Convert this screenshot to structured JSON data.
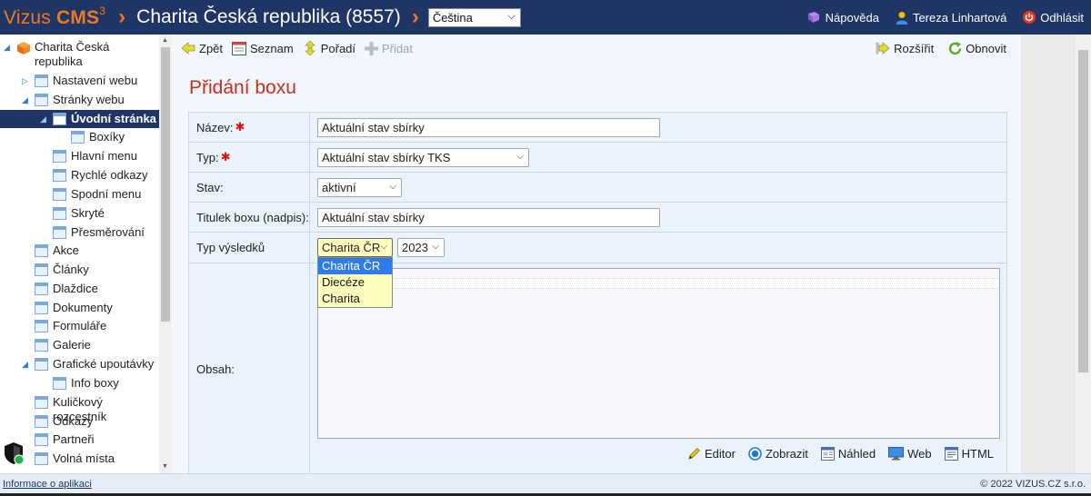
{
  "header": {
    "logo_prefix": "Vizus ",
    "logo_bold": "CMS",
    "logo_sup": "3",
    "site": "Charita Česká republika (8557)",
    "language": "Čeština",
    "help": "Nápověda",
    "user": "Tereza Linhartová",
    "logout": "Odhlásit"
  },
  "sidebar": {
    "root": "Charita Česká republika",
    "items": [
      {
        "label": "Nastavení webu"
      },
      {
        "label": "Stránky webu"
      },
      {
        "label": "Úvodní stránka"
      },
      {
        "label": "Boxíky"
      },
      {
        "label": "Hlavní menu"
      },
      {
        "label": "Rychlé odkazy"
      },
      {
        "label": "Spodní menu"
      },
      {
        "label": "Skryté"
      },
      {
        "label": "Přesměrování"
      },
      {
        "label": "Akce"
      },
      {
        "label": "Články"
      },
      {
        "label": "Dlaždice"
      },
      {
        "label": "Dokumenty"
      },
      {
        "label": "Formuláře"
      },
      {
        "label": "Galerie"
      },
      {
        "label": "Grafické upoutávky"
      },
      {
        "label": "Info boxy"
      },
      {
        "label": "Kuličkový rozcestník"
      },
      {
        "label": "Odkazy"
      },
      {
        "label": "Partneři"
      },
      {
        "label": "Volná místa"
      }
    ]
  },
  "toolbar": {
    "back": "Zpět",
    "list": "Seznam",
    "order": "Pořadí",
    "add": "Přidat",
    "expand": "Rozšířit",
    "refresh": "Obnovit"
  },
  "page_title": "Přidání boxu",
  "form": {
    "name_label": "Název:",
    "name_value": "Aktuální stav sbírky",
    "type_label": "Typ:",
    "type_value": "Aktuální stav sbírky TKS",
    "status_label": "Stav:",
    "status_value": "aktivní",
    "box_title_label": "Titulek boxu (nadpis):",
    "box_title_value": "Aktuální stav sbírky",
    "result_type_label": "Typ výsledků",
    "result_type_value": "Charita ČR",
    "year_value": "2023",
    "result_options": [
      "Charita ČR",
      "Diecéze",
      "Charita"
    ],
    "content_label": "Obsah:"
  },
  "editor_bar": {
    "editor": "Editor",
    "show": "Zobrazit",
    "preview": "Náhled",
    "web": "Web",
    "html": "HTML"
  },
  "footer": {
    "info": "Informace o aplikaci",
    "copyright": "© 2022 VIZUS.CZ s.r.o."
  },
  "colors": {
    "header_bg": "#1e3566",
    "accent_orange": "#f07a1a",
    "title_red": "#cc2e1a",
    "panel_bg": "#f1f7fd"
  }
}
